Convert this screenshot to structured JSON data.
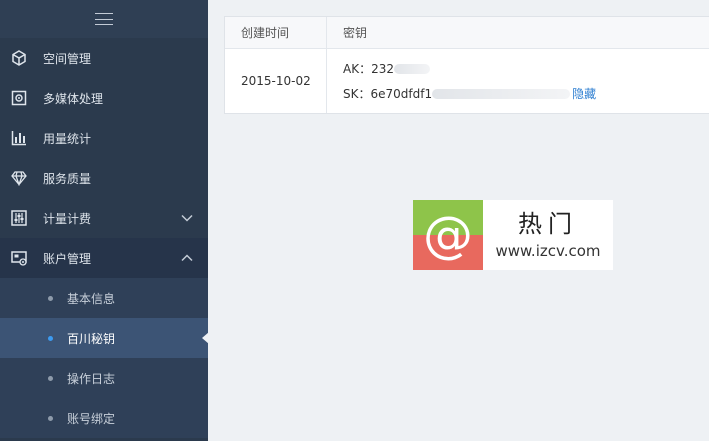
{
  "sidebar": {
    "items": [
      {
        "label": "空间管理",
        "icon": "cube-icon"
      },
      {
        "label": "多媒体处理",
        "icon": "media-gear-icon"
      },
      {
        "label": "用量统计",
        "icon": "bar-chart-icon"
      },
      {
        "label": "服务质量",
        "icon": "diamond-icon"
      },
      {
        "label": "计量计费",
        "icon": "sliders-icon"
      },
      {
        "label": "账户管理",
        "icon": "account-card-icon"
      }
    ],
    "sub_items": [
      {
        "label": "基本信息"
      },
      {
        "label": "百川秘钥"
      },
      {
        "label": "操作日志"
      },
      {
        "label": "账号绑定"
      }
    ]
  },
  "table": {
    "headers": [
      "创建时间",
      "密钥"
    ],
    "rows": [
      {
        "created": "2015-10-02",
        "ak_label": "AK：",
        "ak_value": "232",
        "sk_label": "SK：",
        "sk_value": "6e70dfdf1",
        "toggle_label": "隐藏"
      }
    ]
  },
  "watermark": {
    "symbol": "@",
    "chinese": "热门",
    "url": "www.izcv.com"
  },
  "colors": {
    "sidebar_bg": "#2b3a4d",
    "active_item": "#3c5475",
    "link": "#2f7fd1"
  }
}
